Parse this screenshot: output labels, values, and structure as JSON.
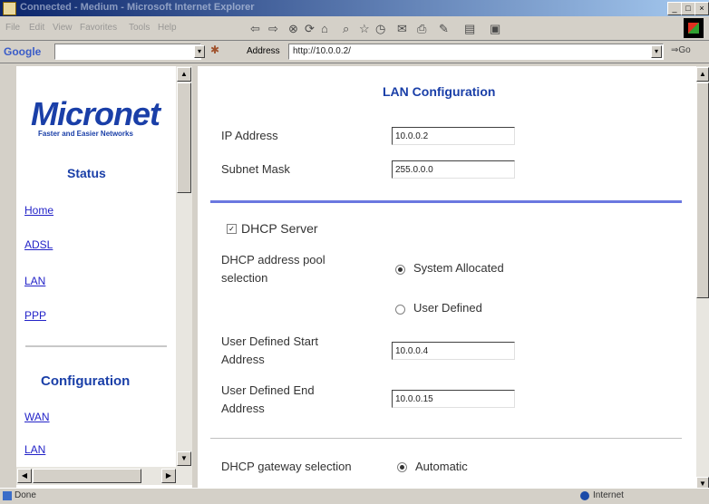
{
  "window": {
    "title": "Connected - Medium - Microsoft Internet Explorer"
  },
  "menu": [
    "File",
    "Edit",
    "View",
    "Favorites",
    "Tools",
    "Help"
  ],
  "toolbar": {
    "google_label": "Google",
    "address_label": "Address",
    "address_value": "http://10.0.0.2/"
  },
  "status_bar": {
    "left": "Done",
    "zone": "Internet"
  },
  "sidebar": {
    "logo": "Micronet",
    "tagline": "Faster and Easier Networks",
    "status_heading": "Status",
    "status_links": [
      "Home",
      "ADSL",
      "LAN",
      "PPP"
    ],
    "config_heading": "Configuration",
    "config_links": [
      "WAN",
      "LAN"
    ]
  },
  "main": {
    "heading": "LAN Configuration",
    "ip_label": "IP Address",
    "ip_value": "10.0.0.2",
    "mask_label": "Subnet Mask",
    "mask_value": "255.0.0.0",
    "dhcp_server_label": "DHCP Server",
    "pool_label_line1": "DHCP address pool",
    "pool_label_line2": "selection",
    "pool_option_system": "System Allocated",
    "pool_option_user": "User Defined",
    "start_label_line1": "User Defined Start",
    "start_label_line2": "Address",
    "start_value": "10.0.0.4",
    "end_label_line1": "User Defined End",
    "end_label_line2": "Address",
    "end_value": "10.0.0.15",
    "gateway_label": "DHCP gateway selection",
    "gateway_option": "Automatic"
  },
  "colors": {
    "brand_blue": "#1a3fa8",
    "divider_blue": "#6b78e0",
    "link_blue": "#2323c8"
  }
}
